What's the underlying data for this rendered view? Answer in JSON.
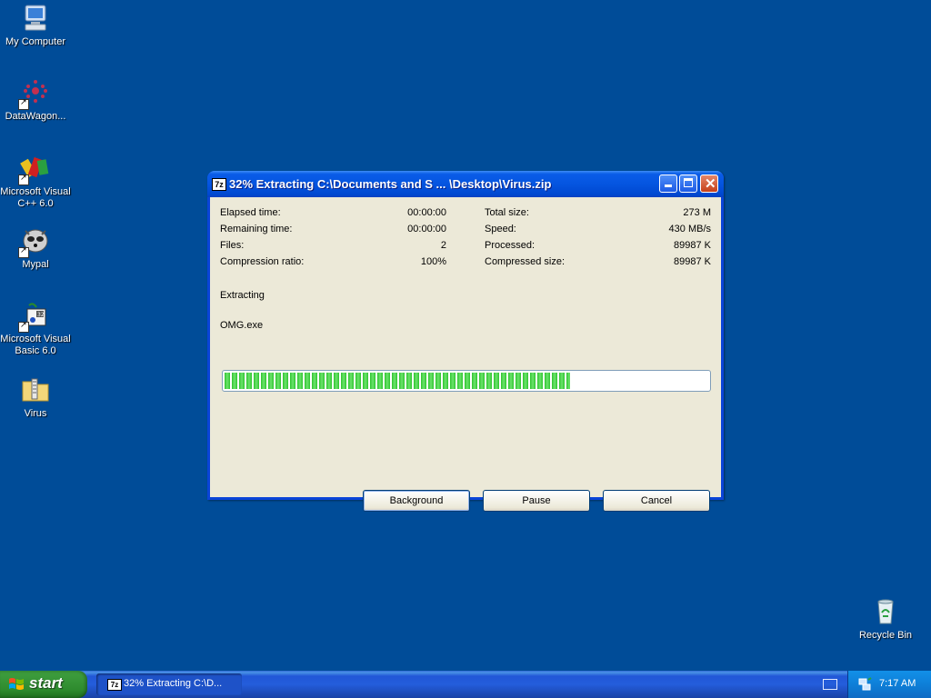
{
  "desktop": {
    "icons": [
      {
        "label": "My Computer",
        "icon": "computer-icon"
      },
      {
        "label": "DataWagon...",
        "icon": "datawagon-icon"
      },
      {
        "label": "Microsoft Visual C++ 6.0",
        "icon": "visual-cpp-icon"
      },
      {
        "label": "Mypal",
        "icon": "mypal-icon"
      },
      {
        "label": "Microsoft Visual Basic 6.0",
        "icon": "visual-basic-icon"
      },
      {
        "label": "Virus",
        "icon": "zip-folder-icon"
      },
      {
        "label": "Recycle Bin",
        "icon": "recycle-bin-icon"
      }
    ]
  },
  "dialog": {
    "title": "32% Extracting C:\\Documents and S ... \\Desktop\\Virus.zip",
    "app_icon": "7z",
    "stats_left": [
      {
        "label": "Elapsed time:",
        "value": "00:00:00"
      },
      {
        "label": "Remaining time:",
        "value": "00:00:00"
      },
      {
        "label": "Files:",
        "value": "2"
      },
      {
        "label": "Compression ratio:",
        "value": "100%"
      }
    ],
    "stats_right": [
      {
        "label": "Total size:",
        "value": "273 M"
      },
      {
        "label": "Speed:",
        "value": "430 MB/s"
      },
      {
        "label": "Processed:",
        "value": "89987 K"
      },
      {
        "label": "Compressed size:",
        "value": "89987 K"
      }
    ],
    "status": "Extracting",
    "current_file": "OMG.exe",
    "progress_fraction": 0.715,
    "buttons": {
      "background": "Background",
      "pause": "Pause",
      "cancel": "Cancel"
    }
  },
  "taskbar": {
    "start_label": "start",
    "task_label": "32% Extracting C:\\D...",
    "task_icon": "7z",
    "clock": "7:17 AM"
  }
}
